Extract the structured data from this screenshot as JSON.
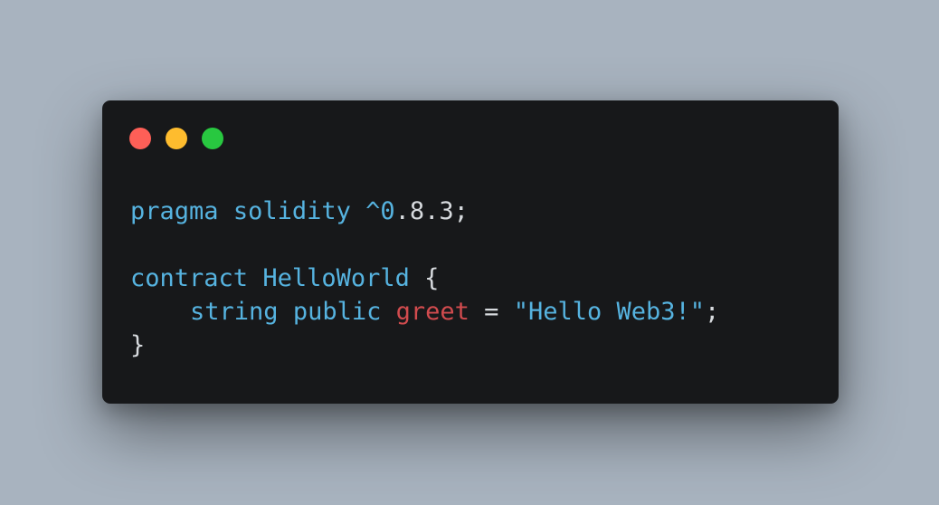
{
  "colors": {
    "background": "#a8b3bf",
    "window": "#17181a",
    "keyword": "#56b3e0",
    "identifier": "#d14b4e",
    "plain": "#d7dade",
    "dot_close": "#fe5f57",
    "dot_minimize": "#febc2e",
    "dot_maximize": "#28c840"
  },
  "window_controls": {
    "close_icon": "red-circle",
    "minimize_icon": "yellow-circle",
    "maximize_icon": "green-circle"
  },
  "code": {
    "line1": {
      "kw1": "pragma",
      "kw2": "solidity",
      "version_prefix": "^0",
      "version_rest": ".8.3;"
    },
    "line3": {
      "kw": "contract",
      "name": "HelloWorld",
      "brace": "{"
    },
    "line4": {
      "type": "string",
      "modifier": "public",
      "var": "greet",
      "op": "=",
      "string": "\"Hello Web3!\"",
      "semi": ";"
    },
    "line5": {
      "brace": "}"
    }
  }
}
